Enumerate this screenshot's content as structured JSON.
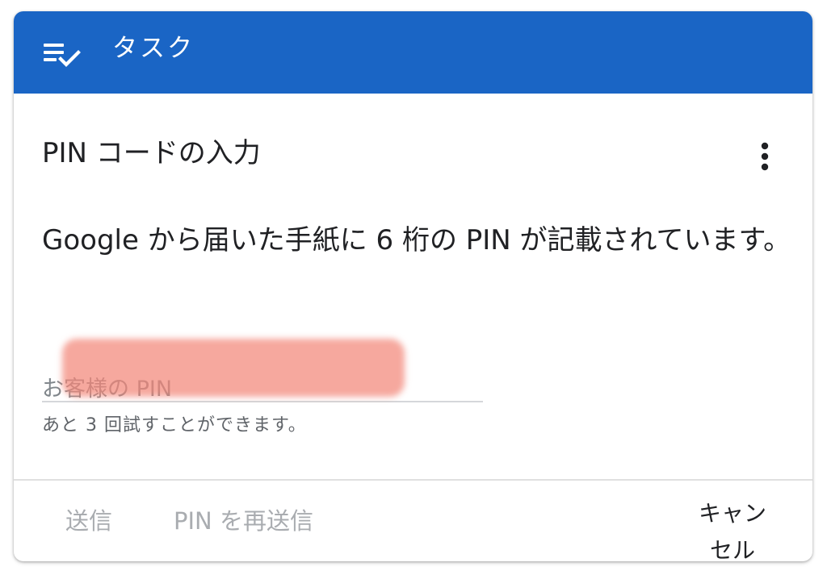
{
  "header": {
    "icon": "task-checklist-icon",
    "title": "タスク",
    "color": "#1a65c5"
  },
  "task": {
    "title": "PIN コードの入力",
    "menu_icon": "more-vert-icon",
    "description": "Google から届いた手紙に 6 桁の PIN が記載されています。"
  },
  "pin_field": {
    "placeholder": "お客様の PIN",
    "value": "",
    "helper": "あと 3 回試すことができます。"
  },
  "actions": {
    "send": "送信",
    "resend": "PIN を再送信",
    "cancel": "キャンセル"
  }
}
